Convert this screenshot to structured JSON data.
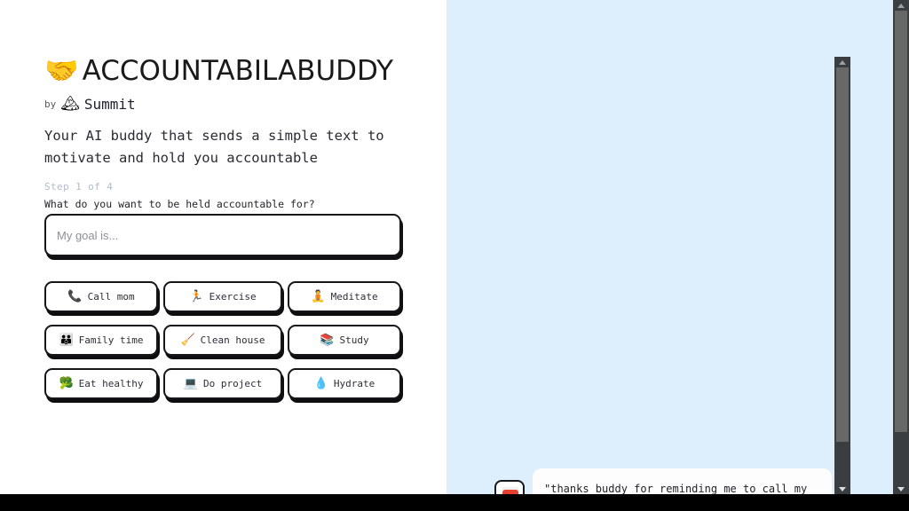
{
  "brand": {
    "logo_icon": "handshake-emoji",
    "logo_glyph": "🤝",
    "title": "ACCOUNTABILABUDDY",
    "by_word": "by",
    "maker_icon": "snow-capped-mountain-emoji",
    "maker_glyph": "🏔",
    "maker_name": "Summit",
    "tagline": "Your AI buddy that sends a simple text to motivate and hold you accountable"
  },
  "wizard": {
    "step_label": "Step 1 of 4",
    "question": "What do you want to be held accountable for?",
    "input_placeholder": "My goal is...",
    "input_value": ""
  },
  "quick_picks": [
    {
      "label": "Call mom",
      "icon": "telephone-receiver-icon",
      "glyph": "📞"
    },
    {
      "label": "Exercise",
      "icon": "person-running-icon",
      "glyph": "🏃"
    },
    {
      "label": "Meditate",
      "icon": "person-in-lotus-icon",
      "glyph": "🧘"
    },
    {
      "label": "Family time",
      "icon": "family-icon",
      "glyph": "👪"
    },
    {
      "label": "Clean house",
      "icon": "broom-icon",
      "glyph": "🧹"
    },
    {
      "label": "Study",
      "icon": "books-icon",
      "glyph": "📚"
    },
    {
      "label": "Eat healthy",
      "icon": "broccoli-icon",
      "glyph": "🥦"
    },
    {
      "label": "Do project",
      "icon": "laptop-icon",
      "glyph": "💻"
    },
    {
      "label": "Hydrate",
      "icon": "droplet-icon",
      "glyph": "💧"
    }
  ],
  "testimonial": {
    "quote": "\"thanks buddy for reminding me to call my",
    "avatar_icon": "user-avatar"
  },
  "scrollbars": {
    "inner": {
      "up_icon": "scroll-up-arrow-icon",
      "down_icon": "scroll-down-arrow-icon"
    },
    "outer": {
      "up_icon": "scroll-up-arrow-icon",
      "down_icon": "scroll-down-arrow-icon"
    }
  },
  "colors": {
    "panel_blue": "#ddeefc",
    "outline_black": "#15151a",
    "step_gray": "#b3bcc9",
    "scrollbar_track": "#3b3e41",
    "scrollbar_thumb": "#686868"
  }
}
